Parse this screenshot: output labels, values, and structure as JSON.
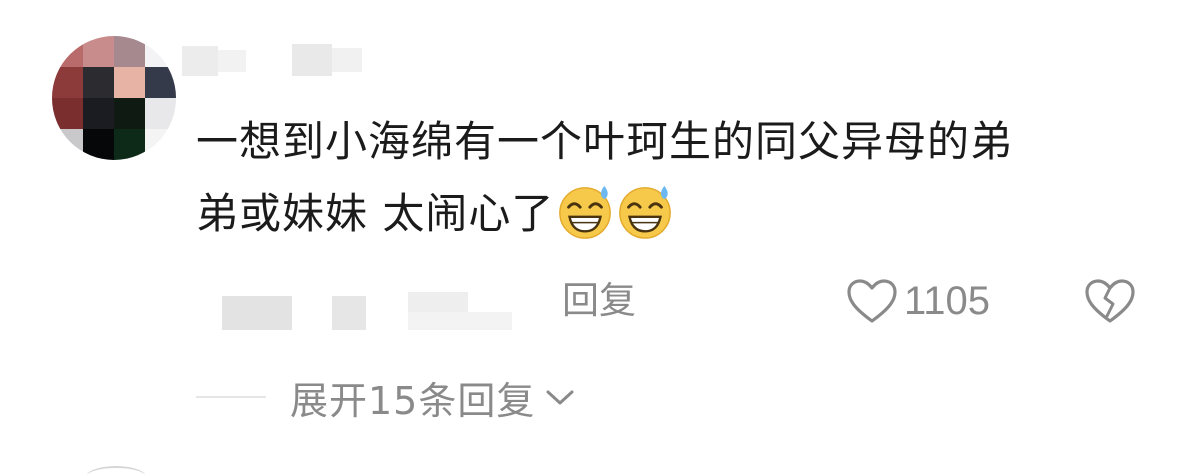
{
  "comment": {
    "text_lines": [
      "一想到小海绵有一个叶珂生的同父异母的弟",
      "弟或妹妹  太闹心了"
    ],
    "emojis": [
      "grinning-sweat-emoji",
      "grinning-sweat-emoji"
    ],
    "actions": {
      "reply_label": "回复",
      "like_count": "1105",
      "like_icon": "heart-outline-icon",
      "dislike_icon": "broken-heart-icon"
    },
    "expand": {
      "label": "展开15条回复",
      "icon": "chevron-down-icon"
    }
  },
  "colors": {
    "text_primary": "#1b1b1b",
    "text_secondary": "#8a8a8a",
    "background": "#ffffff",
    "emoji_face": "#f7c94a",
    "emoji_sweat": "#6db8f0"
  }
}
